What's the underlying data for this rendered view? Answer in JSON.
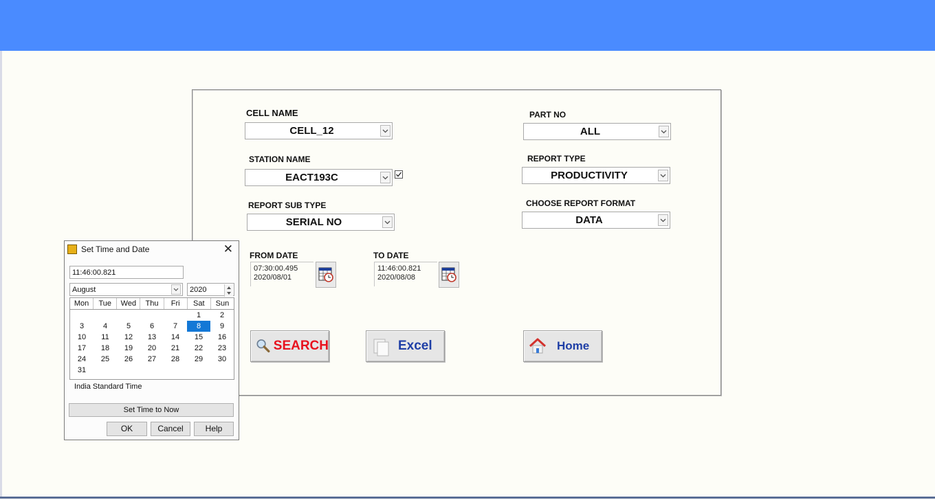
{
  "form": {
    "cell_name": {
      "label": "CELL NAME",
      "value": "CELL_12"
    },
    "station_name": {
      "label": "STATION NAME",
      "value": "EACT193C"
    },
    "report_sub_type": {
      "label": "REPORT  SUB  TYPE",
      "value": "SERIAL NO"
    },
    "part_no": {
      "label": "PART NO",
      "value": "ALL"
    },
    "report_type": {
      "label": "REPORT TYPE",
      "value": "PRODUCTIVITY"
    },
    "report_format": {
      "label": "CHOOSE  REPORT FORMAT",
      "value": "DATA"
    },
    "from_date": {
      "label": "FROM DATE",
      "time": "07:30:00.495",
      "date": "2020/08/01"
    },
    "to_date": {
      "label": "TO DATE",
      "time": "11:46:00.821",
      "date": "2020/08/08"
    }
  },
  "buttons": {
    "search": "SEARCH",
    "excel": "Excel",
    "home": "Home"
  },
  "dialog": {
    "title": "Set Time and Date",
    "time": "11:46:00.821",
    "month": "August",
    "year": "2020",
    "weekdays": [
      "Mon",
      "Tue",
      "Wed",
      "Thu",
      "Fri",
      "Sat",
      "Sun"
    ],
    "weeks": [
      [
        "",
        "",
        "",
        "",
        "",
        "1",
        "2"
      ],
      [
        "3",
        "4",
        "5",
        "6",
        "7",
        "8",
        "9"
      ],
      [
        "10",
        "11",
        "12",
        "13",
        "14",
        "15",
        "16"
      ],
      [
        "17",
        "18",
        "19",
        "20",
        "21",
        "22",
        "23"
      ],
      [
        "24",
        "25",
        "26",
        "27",
        "28",
        "29",
        "30"
      ],
      [
        "31",
        "",
        "",
        "",
        "",
        "",
        ""
      ]
    ],
    "selected_day": "8",
    "timezone": "India Standard Time",
    "set_now": "Set Time to Now",
    "ok": "OK",
    "cancel": "Cancel",
    "help": "Help"
  },
  "colors": {
    "topbar": "#4a8bff",
    "search_text": "#e8121e",
    "excel_text": "#1f3fa6",
    "home_text": "#1f3fa6",
    "selected_day": "#1378d6"
  }
}
